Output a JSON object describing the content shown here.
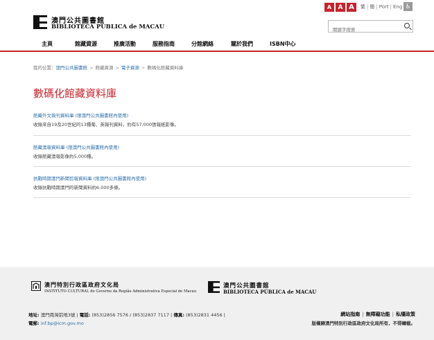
{
  "header": {
    "logo_cn": "澳門公共圖書館",
    "logo_pt": "BIBLIOTECA PÚBLICA de MACAU",
    "font_sizes": [
      "A",
      "A",
      "A"
    ],
    "languages": [
      "繁",
      "簡",
      "Port",
      "Eng"
    ],
    "search_placeholder": "關鍵字搜索"
  },
  "nav": {
    "items": [
      "主頁",
      "館藏資源",
      "推廣活動",
      "服務指南",
      "分館網絡",
      "關於我們",
      "ISBN中心"
    ]
  },
  "breadcrumb": {
    "prefix": "我的位置：",
    "items": [
      "澳門公共圖書館",
      "館藏資源",
      "電子資源",
      "數碼化館藏資料庫"
    ]
  },
  "main": {
    "title": "數碼化館藏資料庫",
    "entries": [
      {
        "title": "館藏外文報刊資料庫 (限澳門公共圖書館內使用)",
        "desc": "收錄來自19及20世紀的13種葡、英報刊資料，約有57,000張報紙影像。"
      },
      {
        "title": "館藏澳報資料庫 (限澳門公共圖書館內使用)",
        "desc": "收錄館藏澳報影像約5,000種。"
      },
      {
        "title": "抗戰時期澳門新聞剪報資料庫 (限澳門公共圖書館內使用)",
        "desc": "收錄抗戰時期澳門的新聞資料約6,000多條。"
      }
    ]
  },
  "footer": {
    "ic_cn": "澳門特別行政區政府文化局",
    "ic_pt": "INSTITUTO CULTURAL do Governo da Região Administrativa Especial de Macau",
    "lib_cn": "澳門公共圖書館",
    "lib_pt": "BIBLIOTECA PÚBLICA de MACAU",
    "address_label": "地址:",
    "address": "澳門南灣前地3號",
    "phone_label": "電話:",
    "phone": "(853)2856 7576 / (853)2837 7117",
    "fax_label": "傳真:",
    "fax": "(853)2831 4456",
    "email_label": "電郵:",
    "email": "inf.bp@icm.gov.mo",
    "links": [
      "網站指南",
      "無障礙功能",
      "私隱政策"
    ],
    "copyright": "版權歸澳門特別行政區政府文化局所有，不得轉載。"
  },
  "colors": {
    "accent": "#c8232c",
    "link": "#2a6ea8",
    "footer_bg": "#f0f0f0"
  }
}
